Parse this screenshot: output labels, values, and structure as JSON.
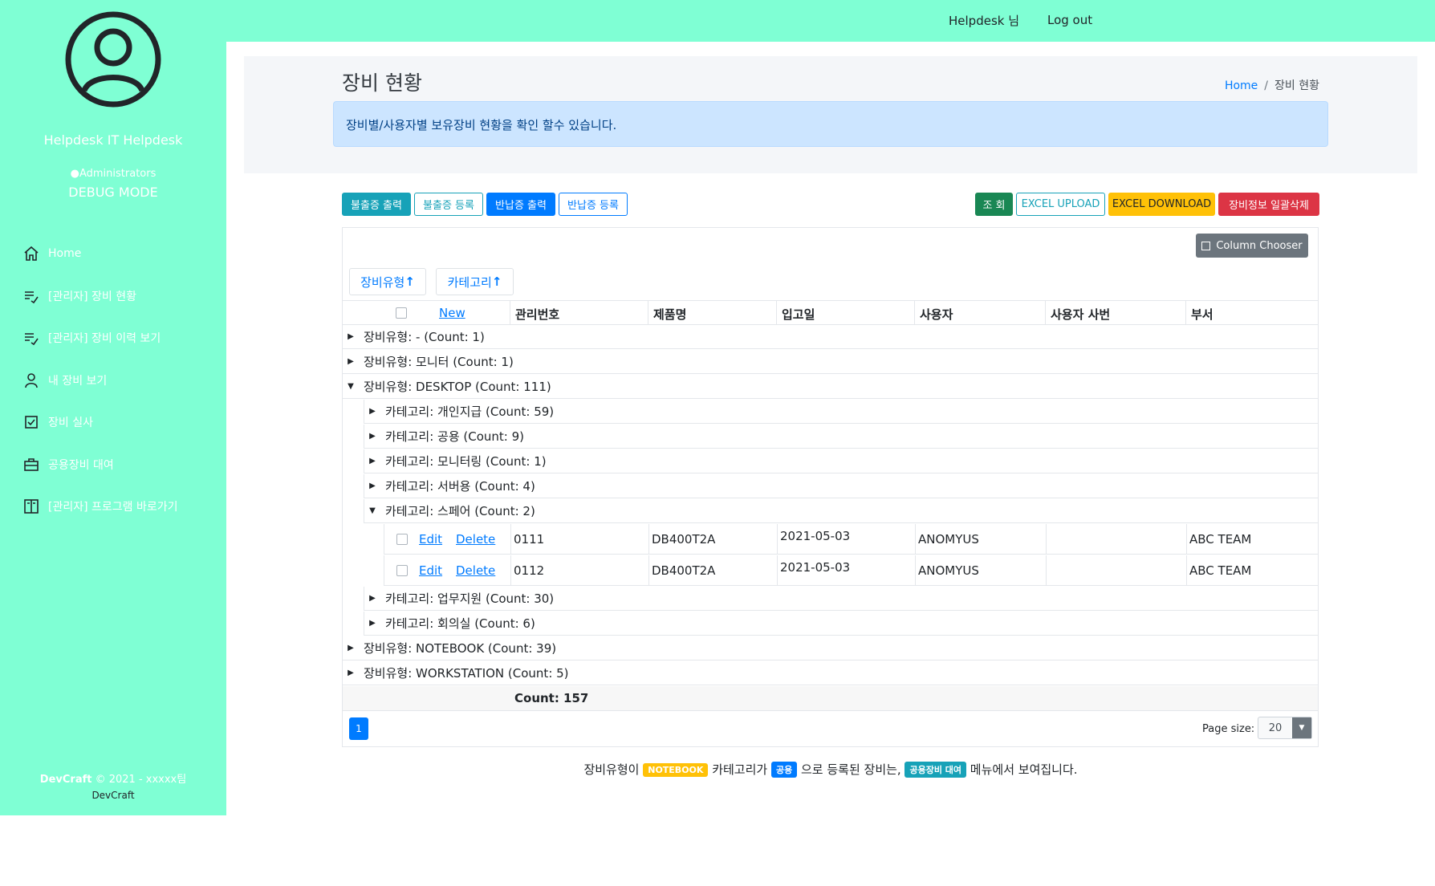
{
  "sidebar": {
    "user_name": "Helpdesk IT Helpdesk",
    "role": "Administrators",
    "mode": "DEBUG MODE",
    "items": [
      {
        "label": "Home",
        "icon": "home-icon"
      },
      {
        "label": "[관리자] 장비 현황",
        "icon": "list-edit-icon"
      },
      {
        "label": "[관리자] 장비 이력 보기",
        "icon": "list-edit-icon"
      },
      {
        "label": "내 장비 보기",
        "icon": "user-icon"
      },
      {
        "label": "장비 실사",
        "icon": "checkbox-icon"
      },
      {
        "label": "공용장비 대여",
        "icon": "briefcase-icon"
      },
      {
        "label": "[관리자] 프로그램 바로가기",
        "icon": "book-icon"
      }
    ],
    "footer_brand": "DevCraft",
    "footer_rest": " © 2021 - xxxxx팀",
    "footer_sub": "DevCraft"
  },
  "topbar": {
    "user": "Helpdesk 님",
    "logout": "Log out"
  },
  "header": {
    "title": "장비 현황",
    "breadcrumb_home": "Home",
    "breadcrumb_sep": "/",
    "breadcrumb_current": "장비 현황",
    "alert": "장비별/사용자별 보유장비 현황을 확인 할수 있습니다."
  },
  "toolbar": {
    "btn1": "불출증 출력",
    "btn2": "불출증 등록",
    "btn3": "반납증 출력",
    "btn4": "반납증 등록",
    "search": "조 회",
    "excel_upload": "EXCEL UPLOAD",
    "excel_download": "EXCEL DOWNLOAD",
    "bulk_delete": "장비정보 일괄삭제"
  },
  "grid": {
    "column_chooser": "Column Chooser",
    "group_chips": [
      "장비유형",
      "카테고리"
    ],
    "sort_arrow": "↑",
    "header": {
      "new": "New",
      "cols": [
        "관리번호",
        "제품명",
        "입고일",
        "사용자",
        "사용자 사번",
        "부서"
      ]
    },
    "groups": [
      {
        "label": "장비유형: - (Count: 1)"
      },
      {
        "label": "장비유형: 모니터 (Count: 1)"
      },
      {
        "label": "장비유형: DESKTOP (Count: 111)"
      },
      {
        "label": "카테고리: 개인지급 (Count: 59)"
      },
      {
        "label": "카테고리: 공용 (Count: 9)"
      },
      {
        "label": "카테고리: 모니터링 (Count: 1)"
      },
      {
        "label": "카테고리: 서버용 (Count: 4)"
      },
      {
        "label": "카테고리: 스페어 (Count: 2)"
      },
      {
        "label": "카테고리: 업무지원 (Count: 30)"
      },
      {
        "label": "카테고리: 회의실 (Count: 6)"
      },
      {
        "label": "장비유형: NOTEBOOK (Count: 39)"
      },
      {
        "label": "장비유형: WORKSTATION (Count: 5)"
      }
    ],
    "edit": "Edit",
    "delete": "Delete",
    "rows": [
      {
        "id": "0111",
        "product": "DB400T2A",
        "date": "2021-05-03",
        "user": "ANOMYUS",
        "emp_no": "",
        "dept": "ABC TEAM"
      },
      {
        "id": "0112",
        "product": "DB400T2A",
        "date": "2021-05-03",
        "user": "ANOMYUS",
        "emp_no": "",
        "dept": "ABC TEAM"
      }
    ],
    "total": "Count: 157",
    "page": "1",
    "page_size_label": "Page size:",
    "page_size": "20"
  },
  "note": {
    "p1": "장비유형이 ",
    "badge1": "NOTEBOOK",
    "p2": " 카테고리가 ",
    "badge2": "공용",
    "p3": " 으로 등록된 장비는, ",
    "badge3": "공용장비 대여",
    "p4": " 메뉴에서 보여집니다."
  },
  "colors": {
    "accent": "#7fffd4",
    "primary": "#007bff",
    "info": "#17a2b8",
    "success": "#198754",
    "warning": "#ffc107",
    "danger": "#dc3545"
  }
}
